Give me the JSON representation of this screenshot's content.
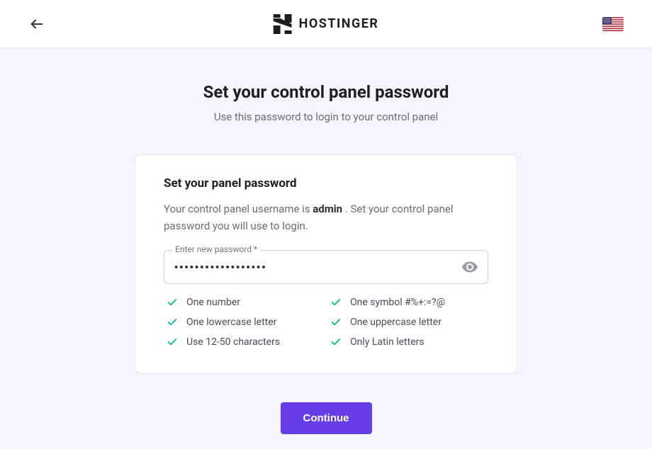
{
  "header": {
    "brand": "HOSTINGER",
    "locale_flag": "us"
  },
  "page": {
    "title": "Set your control panel password",
    "subtitle": "Use this password to login to your control panel"
  },
  "card": {
    "title": "Set your panel password",
    "desc_prefix": "Your control panel username is ",
    "username": "admin",
    "desc_suffix": " . Set your control panel password you will use to login.",
    "input_label": "Enter new password *",
    "input_value": "••••••••••••••••••"
  },
  "rules": [
    {
      "text": "One number",
      "met": true
    },
    {
      "text": "One symbol #%+:=?@",
      "met": true
    },
    {
      "text": "One lowercase letter",
      "met": true
    },
    {
      "text": "One uppercase letter",
      "met": true
    },
    {
      "text": "Use 12-50 characters",
      "met": true
    },
    {
      "text": "Only Latin letters",
      "met": true
    }
  ],
  "actions": {
    "continue": "Continue"
  },
  "colors": {
    "accent": "#673de6",
    "success": "#00b090"
  }
}
